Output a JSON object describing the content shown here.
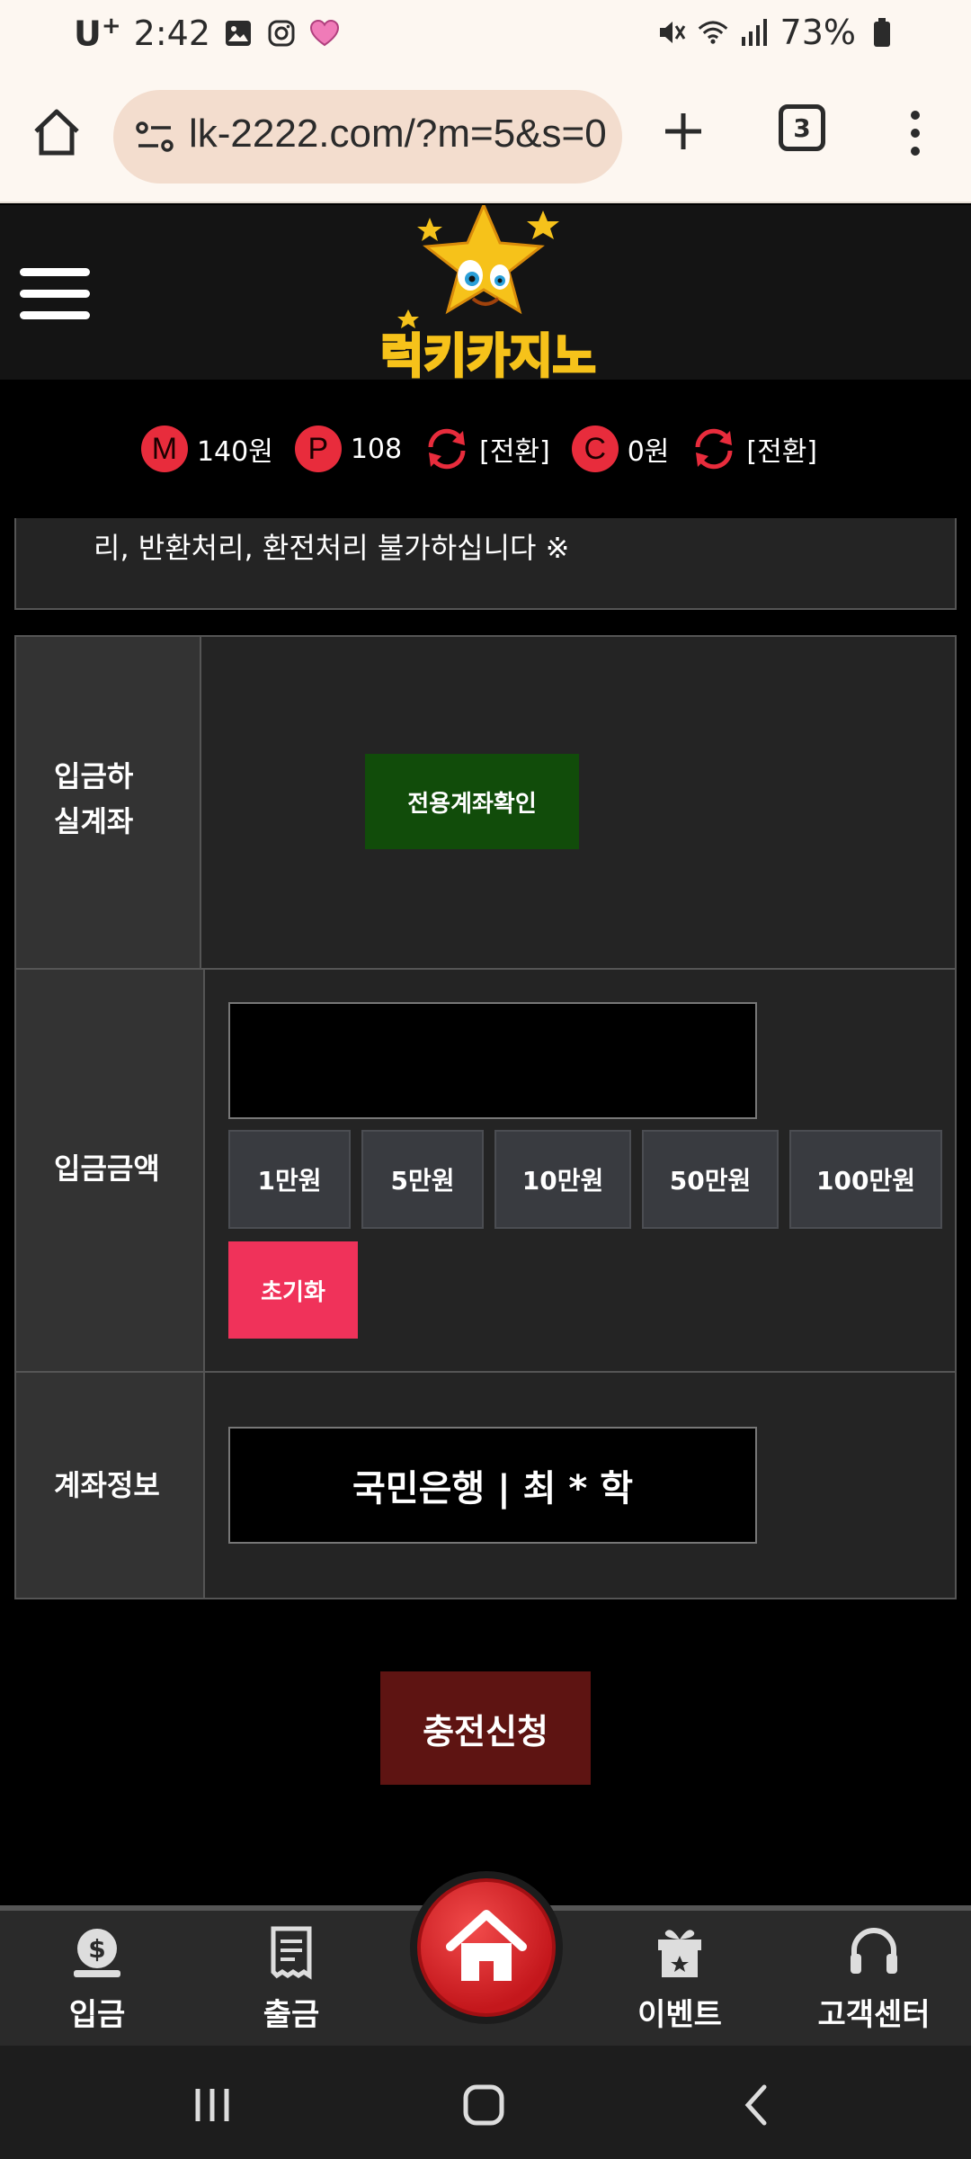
{
  "status_bar": {
    "carrier": "U",
    "carrier_plus": "+",
    "time": "2:42",
    "battery": "73%"
  },
  "browser": {
    "url": "lk-2222.com/?m=5&s=0",
    "tab_count": "3"
  },
  "balance": {
    "m_badge": "M",
    "m_value": "140원",
    "p_badge": "P",
    "p_value": "108",
    "p_convert": "[전환]",
    "c_badge": "C",
    "c_value": "0원",
    "c_convert": "[전환]"
  },
  "notice": {
    "text": "리, 반환처리, 환전처리 불가하십니다 ※"
  },
  "form": {
    "deposit_account_label_line1": "입금하",
    "deposit_account_label_line2": "실계좌",
    "confirm_account_button": "전용계좌확인",
    "amount_label": "입금금액",
    "amount_value": "",
    "amount_buttons": [
      "1만원",
      "5만원",
      "10만원",
      "50만원",
      "100만원"
    ],
    "reset_button": "초기화",
    "account_info_label": "계좌정보",
    "account_info_value": "국민은행 | 최 * 학"
  },
  "submit_button": "충전신청",
  "bottom_nav": {
    "deposit": "입금",
    "withdraw": "출금",
    "event": "이벤트",
    "support": "고객센터"
  },
  "colors": {
    "accent_red": "#e82c3c",
    "confirm_green": "#114c0a",
    "reset_pink": "#f0325a",
    "submit_maroon": "#5e1412"
  }
}
